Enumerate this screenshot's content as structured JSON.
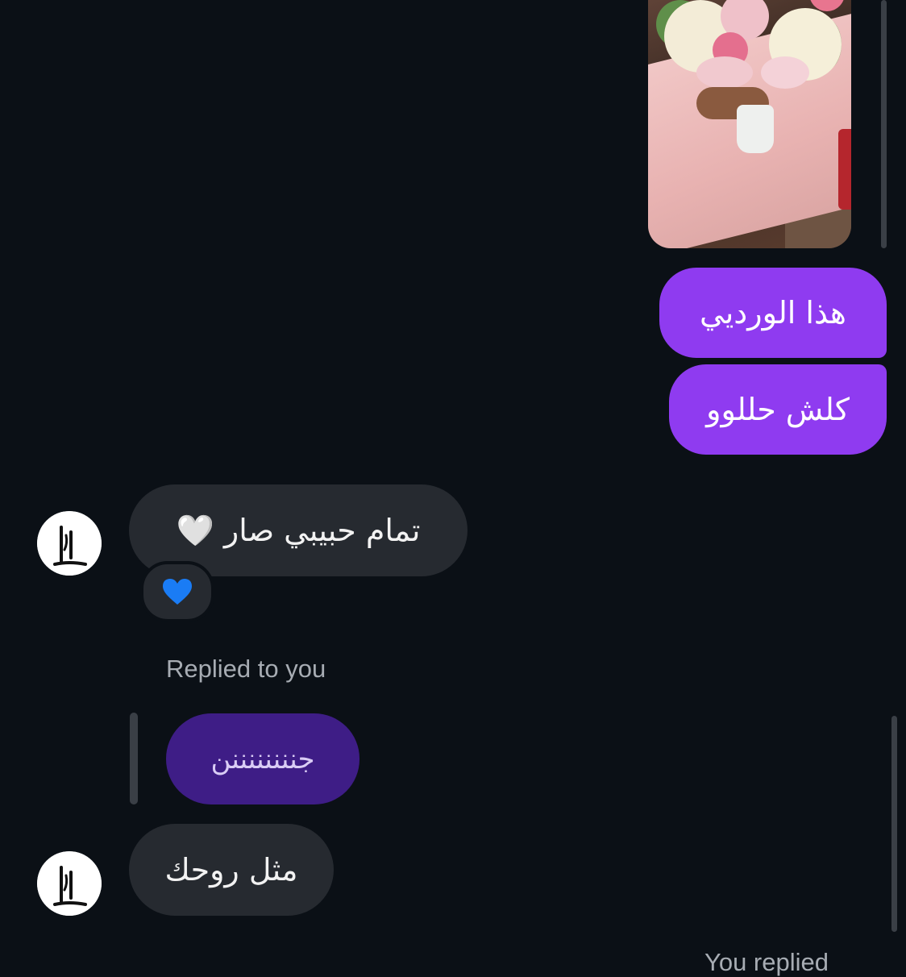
{
  "conversation": {
    "messages": [
      {
        "from": "me",
        "kind": "image"
      },
      {
        "from": "me",
        "text": "هذا الورديي"
      },
      {
        "from": "me",
        "text": "كلش حللوو"
      },
      {
        "from": "them",
        "text": "تمام حبيبي صار 🤍",
        "reaction": "💙"
      },
      {
        "from": "them",
        "reply_label": "Replied to you",
        "quoted_text": "جننننننننن"
      },
      {
        "from": "them",
        "text": "مثل روحك"
      }
    ],
    "footer_label": "You replied"
  },
  "colors": {
    "background": "#0b1016",
    "sent_bubble": "#8f3bf0",
    "received_bubble": "#262a30",
    "quoted_bubble": "#3e1d86",
    "meta_text": "#a7acb3"
  },
  "icons": {
    "avatar": "calligraphy-logo-avatar",
    "reaction": "blue-heart-emoji"
  }
}
